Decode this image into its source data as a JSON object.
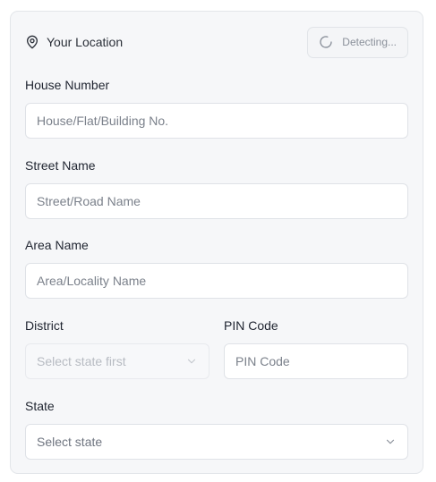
{
  "location": {
    "title": "Your Location",
    "detect_label": "Detecting..."
  },
  "fields": {
    "house_number": {
      "label": "House Number",
      "placeholder": "House/Flat/Building No.",
      "value": ""
    },
    "street_name": {
      "label": "Street Name",
      "placeholder": "Street/Road Name",
      "value": ""
    },
    "area_name": {
      "label": "Area Name",
      "placeholder": "Area/Locality Name",
      "value": ""
    },
    "district": {
      "label": "District",
      "selected": "Select state first",
      "disabled": true
    },
    "pin_code": {
      "label": "PIN Code",
      "placeholder": "PIN Code",
      "value": ""
    },
    "state": {
      "label": "State",
      "selected": "Select state"
    }
  },
  "icons": {
    "location": "map-pin-icon",
    "spinner": "loader-icon",
    "dropdown": "chevron-down-icon"
  },
  "colors": {
    "card_background": "#f6f7f9",
    "border": "#dfe2e7",
    "muted_text": "#8a909a"
  }
}
